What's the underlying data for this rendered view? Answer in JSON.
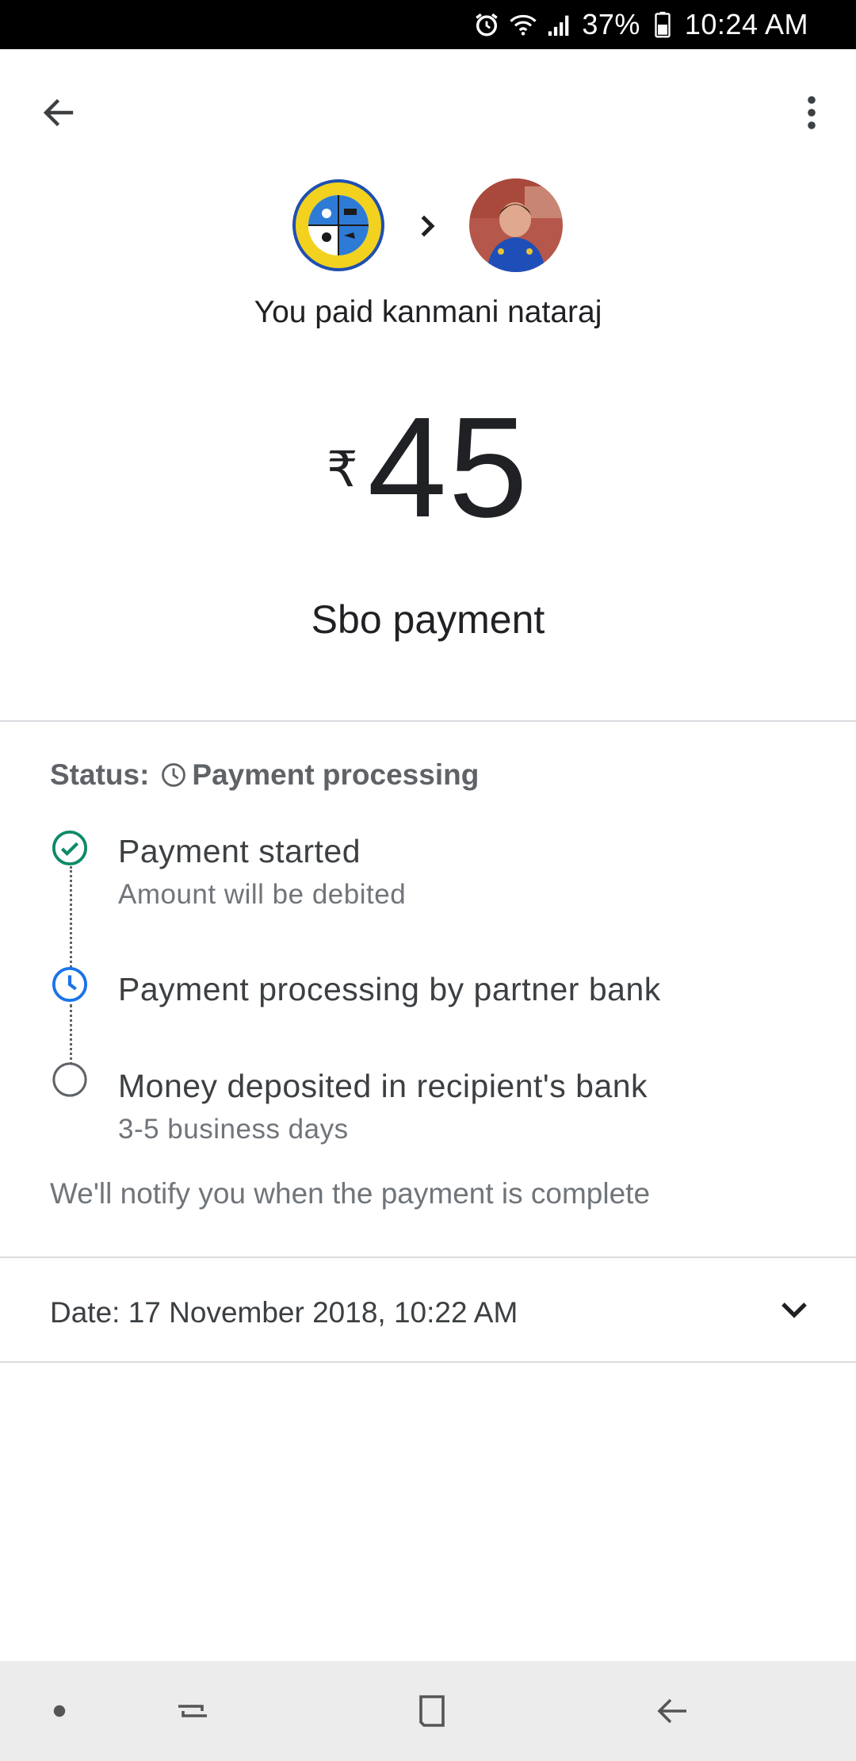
{
  "status_bar": {
    "battery": "37%",
    "time": "10:24 AM",
    "icons": [
      "alarm-icon",
      "wifi-icon",
      "signal-icon",
      "battery-icon"
    ]
  },
  "app_bar": {
    "back_icon": "arrow-back-icon",
    "more_icon": "more-vert-icon"
  },
  "payment": {
    "paid_text": "You paid kanmani nataraj",
    "currency_symbol": "₹",
    "amount": "45",
    "note": "Sbo payment"
  },
  "status": {
    "label": "Status:",
    "value": "Payment processing",
    "icon": "clock-icon",
    "steps": [
      {
        "title": "Payment started",
        "subtitle": "Amount will be debited",
        "state": "done",
        "color": "#0d8a6a"
      },
      {
        "title": "Payment processing by partner bank",
        "subtitle": "",
        "state": "current",
        "color": "#1a73e8"
      },
      {
        "title": "Money deposited in recipient's bank",
        "subtitle": "3-5 business days",
        "state": "pending",
        "color": "#5f6368"
      }
    ],
    "notify_text": "We'll notify you when the payment is complete"
  },
  "details": {
    "date_text": "Date: 17 November 2018, 10:22 AM",
    "expand_icon": "chevron-down-icon"
  },
  "nav_bar": {
    "items": [
      "dot-icon",
      "recent-apps-icon",
      "home-icon",
      "nav-back-icon"
    ]
  },
  "colors": {
    "done": "#0d8a6a",
    "current": "#1a73e8",
    "divider": "#dadce0",
    "nav_bg": "#ececec"
  }
}
